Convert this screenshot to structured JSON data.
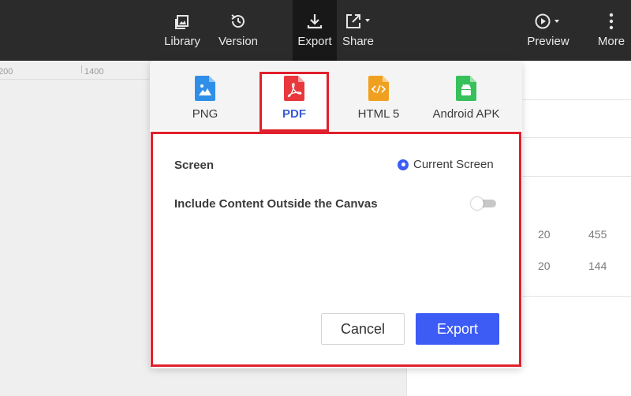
{
  "toolbar": {
    "items": [
      {
        "label": "Library",
        "icon": "library-icon"
      },
      {
        "label": "Version",
        "icon": "history-icon"
      },
      {
        "label": "Export",
        "icon": "download-icon",
        "active": true
      },
      {
        "label": "Share",
        "icon": "share-icon"
      },
      {
        "label": "Preview",
        "icon": "play-icon"
      },
      {
        "label": "More",
        "icon": "more-vertical-icon"
      }
    ]
  },
  "ruler": {
    "labels": [
      "200",
      "1400"
    ]
  },
  "right_panel": {
    "values": [
      [
        "20",
        "455"
      ],
      [
        "20",
        "144"
      ]
    ]
  },
  "export_dialog": {
    "formats": [
      {
        "label": "PNG",
        "icon": "png-file-icon",
        "color": "#2f8fe8"
      },
      {
        "label": "PDF",
        "icon": "pdf-file-icon",
        "color": "#e8383d",
        "selected": true
      },
      {
        "label": "HTML 5",
        "icon": "html-file-icon",
        "color": "#f0a020"
      },
      {
        "label": "Android APK",
        "icon": "apk-file-icon",
        "color": "#37c05b"
      }
    ],
    "screen_label": "Screen",
    "screen_option": "Current Screen",
    "include_label": "Include Content Outside the Canvas",
    "include_enabled": false,
    "cancel_label": "Cancel",
    "export_label": "Export"
  },
  "colors": {
    "accent": "#3d5bf5",
    "highlight": "#e0202c",
    "toolbar_bg": "#2b2b2b"
  }
}
